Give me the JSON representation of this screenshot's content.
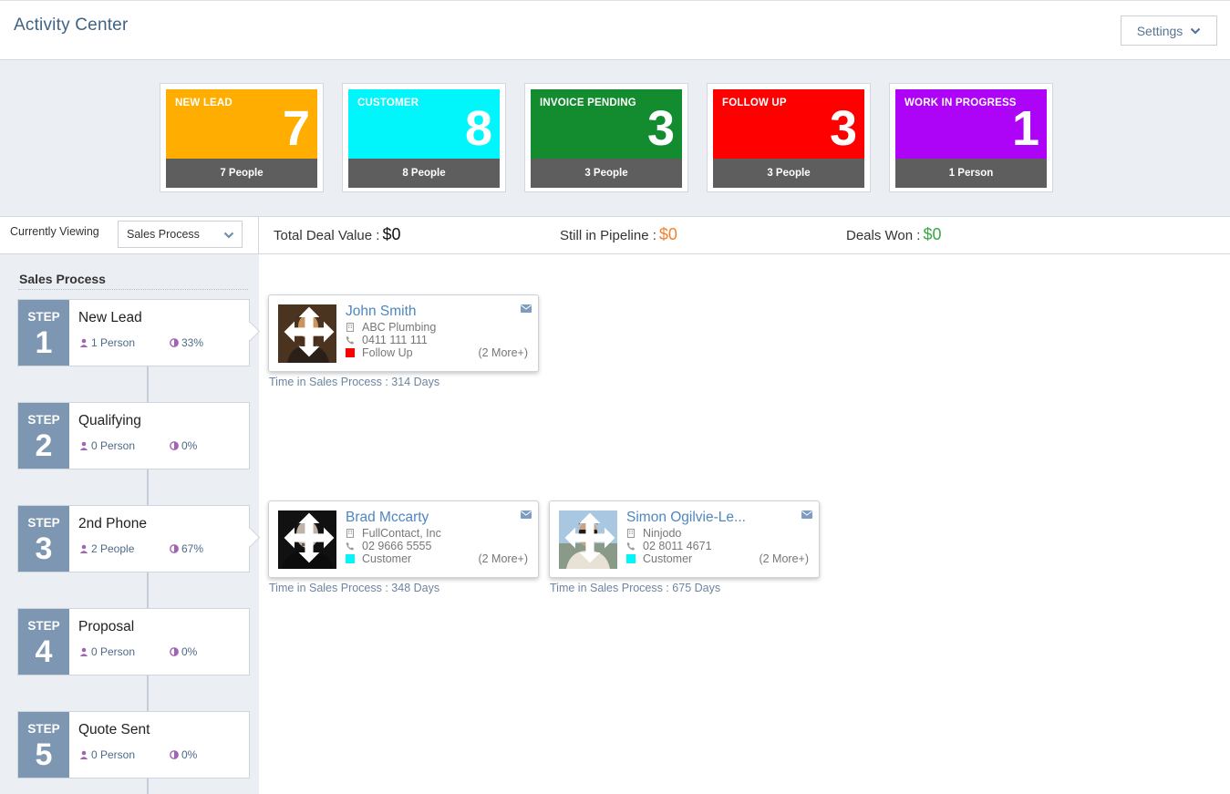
{
  "header": {
    "title": "Activity Center",
    "settings_label": "Settings"
  },
  "tiles": [
    {
      "label": "NEW LEAD",
      "count": "7",
      "people": "7 People",
      "color": "#ffad00"
    },
    {
      "label": "CUSTOMER",
      "count": "8",
      "people": "8 People",
      "color": "#00f6fb"
    },
    {
      "label": "INVOICE PENDING",
      "count": "3",
      "people": "3 People",
      "color": "#138b2f"
    },
    {
      "label": "FOLLOW UP",
      "count": "3",
      "people": "3 People",
      "color": "#fe0000"
    },
    {
      "label": "WORK IN PROGRESS",
      "count": "1",
      "people": "1 Person",
      "color": "#ad04f8"
    }
  ],
  "filter": {
    "viewing_label": "Currently Viewing",
    "selected": "Sales Process"
  },
  "stats": {
    "total_label": "Total Deal Value :",
    "total_value": "$0",
    "total_color": "#111111",
    "pipeline_label": "Still in Pipeline :",
    "pipeline_value": "$0",
    "pipeline_color": "#f0822f",
    "won_label": "Deals Won :",
    "won_value": "$0",
    "won_color": "#3aa844"
  },
  "sidebar": {
    "title": "Sales Process",
    "step_word": "STEP",
    "steps": [
      {
        "num": "1",
        "name": "New Lead",
        "people": "1 Person",
        "percent": "33%"
      },
      {
        "num": "2",
        "name": "Qualifying",
        "people": "0 Person",
        "percent": "0%"
      },
      {
        "num": "3",
        "name": "2nd Phone",
        "people": "2 People",
        "percent": "67%"
      },
      {
        "num": "4",
        "name": "Proposal",
        "people": "0 Person",
        "percent": "0%"
      },
      {
        "num": "5",
        "name": "Quote Sent",
        "people": "0 Person",
        "percent": "0%"
      }
    ]
  },
  "cards": [
    {
      "name": "John Smith",
      "company": "ABC Plumbing",
      "phone": "0411 111 111",
      "status": "Follow Up",
      "status_color": "#fe0000",
      "more": "(2 More+)",
      "time": "Time in Sales Process : 314 Days"
    },
    {
      "name": "Brad Mccarty",
      "company": "FullContact, Inc",
      "phone": "02 9666 5555",
      "status": "Customer",
      "status_color": "#00f6fb",
      "more": "(2 More+)",
      "time": "Time in Sales Process : 348 Days"
    },
    {
      "name": "Simon Ogilvie-Le...",
      "company": "Ninjodo",
      "phone": "02 8011 4671",
      "status": "Customer",
      "status_color": "#00f6fb",
      "more": "(2 More+)",
      "time": "Time in Sales Process : 675 Days"
    }
  ]
}
